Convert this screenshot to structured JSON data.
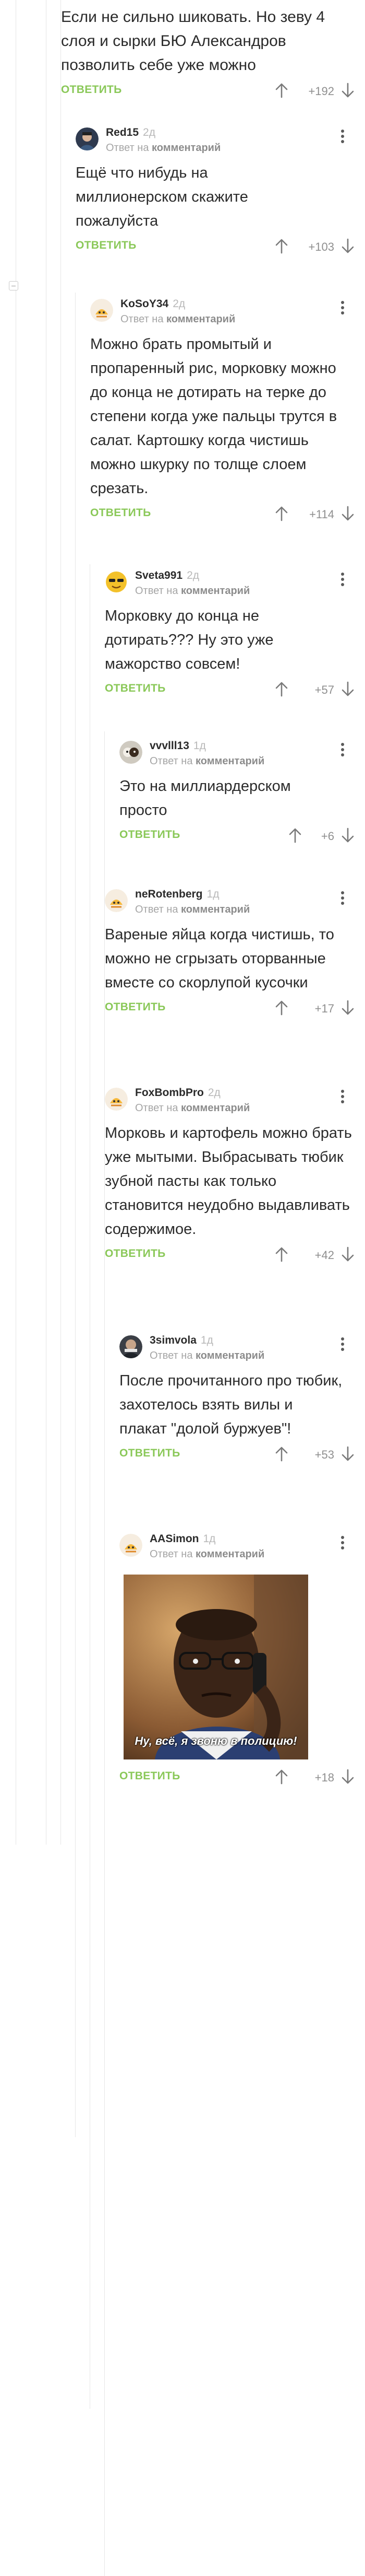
{
  "reply_label": "ОТВЕТИТЬ",
  "reply_to_prefix": "Ответ на",
  "reply_to_link": "комментарий",
  "comments": [
    {
      "text": "Если не сильно шиковать. Но зеву 4 слоя и сырки БЮ Александров позволить себе уже можно",
      "rating": "+192"
    },
    {
      "author": "Red15",
      "time": "2д",
      "text": "Ещё что нибудь на миллионерском скажите пожалуйста",
      "rating": "+103"
    },
    {
      "author": "KoSoY34",
      "time": "2д",
      "text": "Можно брать промытый и пропаренный рис, морковку можно до конца не дотирать на терке до степени когда уже пальцы трутся в салат. Картошку когда чистишь можно шкурку по толще слоем срезать.",
      "rating": "+114"
    },
    {
      "author": "Sveta991",
      "time": "2д",
      "text": "Морковку до конца не дотирать??? Ну это уже мажорство совсем!",
      "rating": "+57"
    },
    {
      "author": "vvvlll13",
      "time": "1д",
      "text": "Это на миллиардерском просто",
      "rating": "+6"
    },
    {
      "author": "neRotenberg",
      "time": "1д",
      "text": "Вареные яйца когда чистишь, то можно не сгрызать оторванные вместе со скорлупой кусочки",
      "rating": "+17"
    },
    {
      "author": "FoxBombPro",
      "time": "2д",
      "text": "Морковь и картофель можно брать уже мытыми. Выбрасывать тюбик зубной пасты как только становится неудобно выдавливать содержимое.",
      "rating": "+42"
    },
    {
      "author": "3simvola",
      "time": "1д",
      "text": "После прочитанного про тюбик, захотелось взять вилы и плакат \"долой буржуев\"!",
      "rating": "+53"
    },
    {
      "author": "AASimon",
      "time": "1д",
      "text": "",
      "image_caption": "Ну, всё, я звоню в полицию!",
      "rating": "+18"
    }
  ],
  "icons": {
    "upvote": "arrow-up-icon",
    "downvote": "arrow-down-icon",
    "more": "more-vertical-icon",
    "collapse": "collapse-minus-icon"
  },
  "colors": {
    "reply": "#8ac858",
    "text": "#2b2b2b",
    "muted": "#a5a5a5"
  }
}
